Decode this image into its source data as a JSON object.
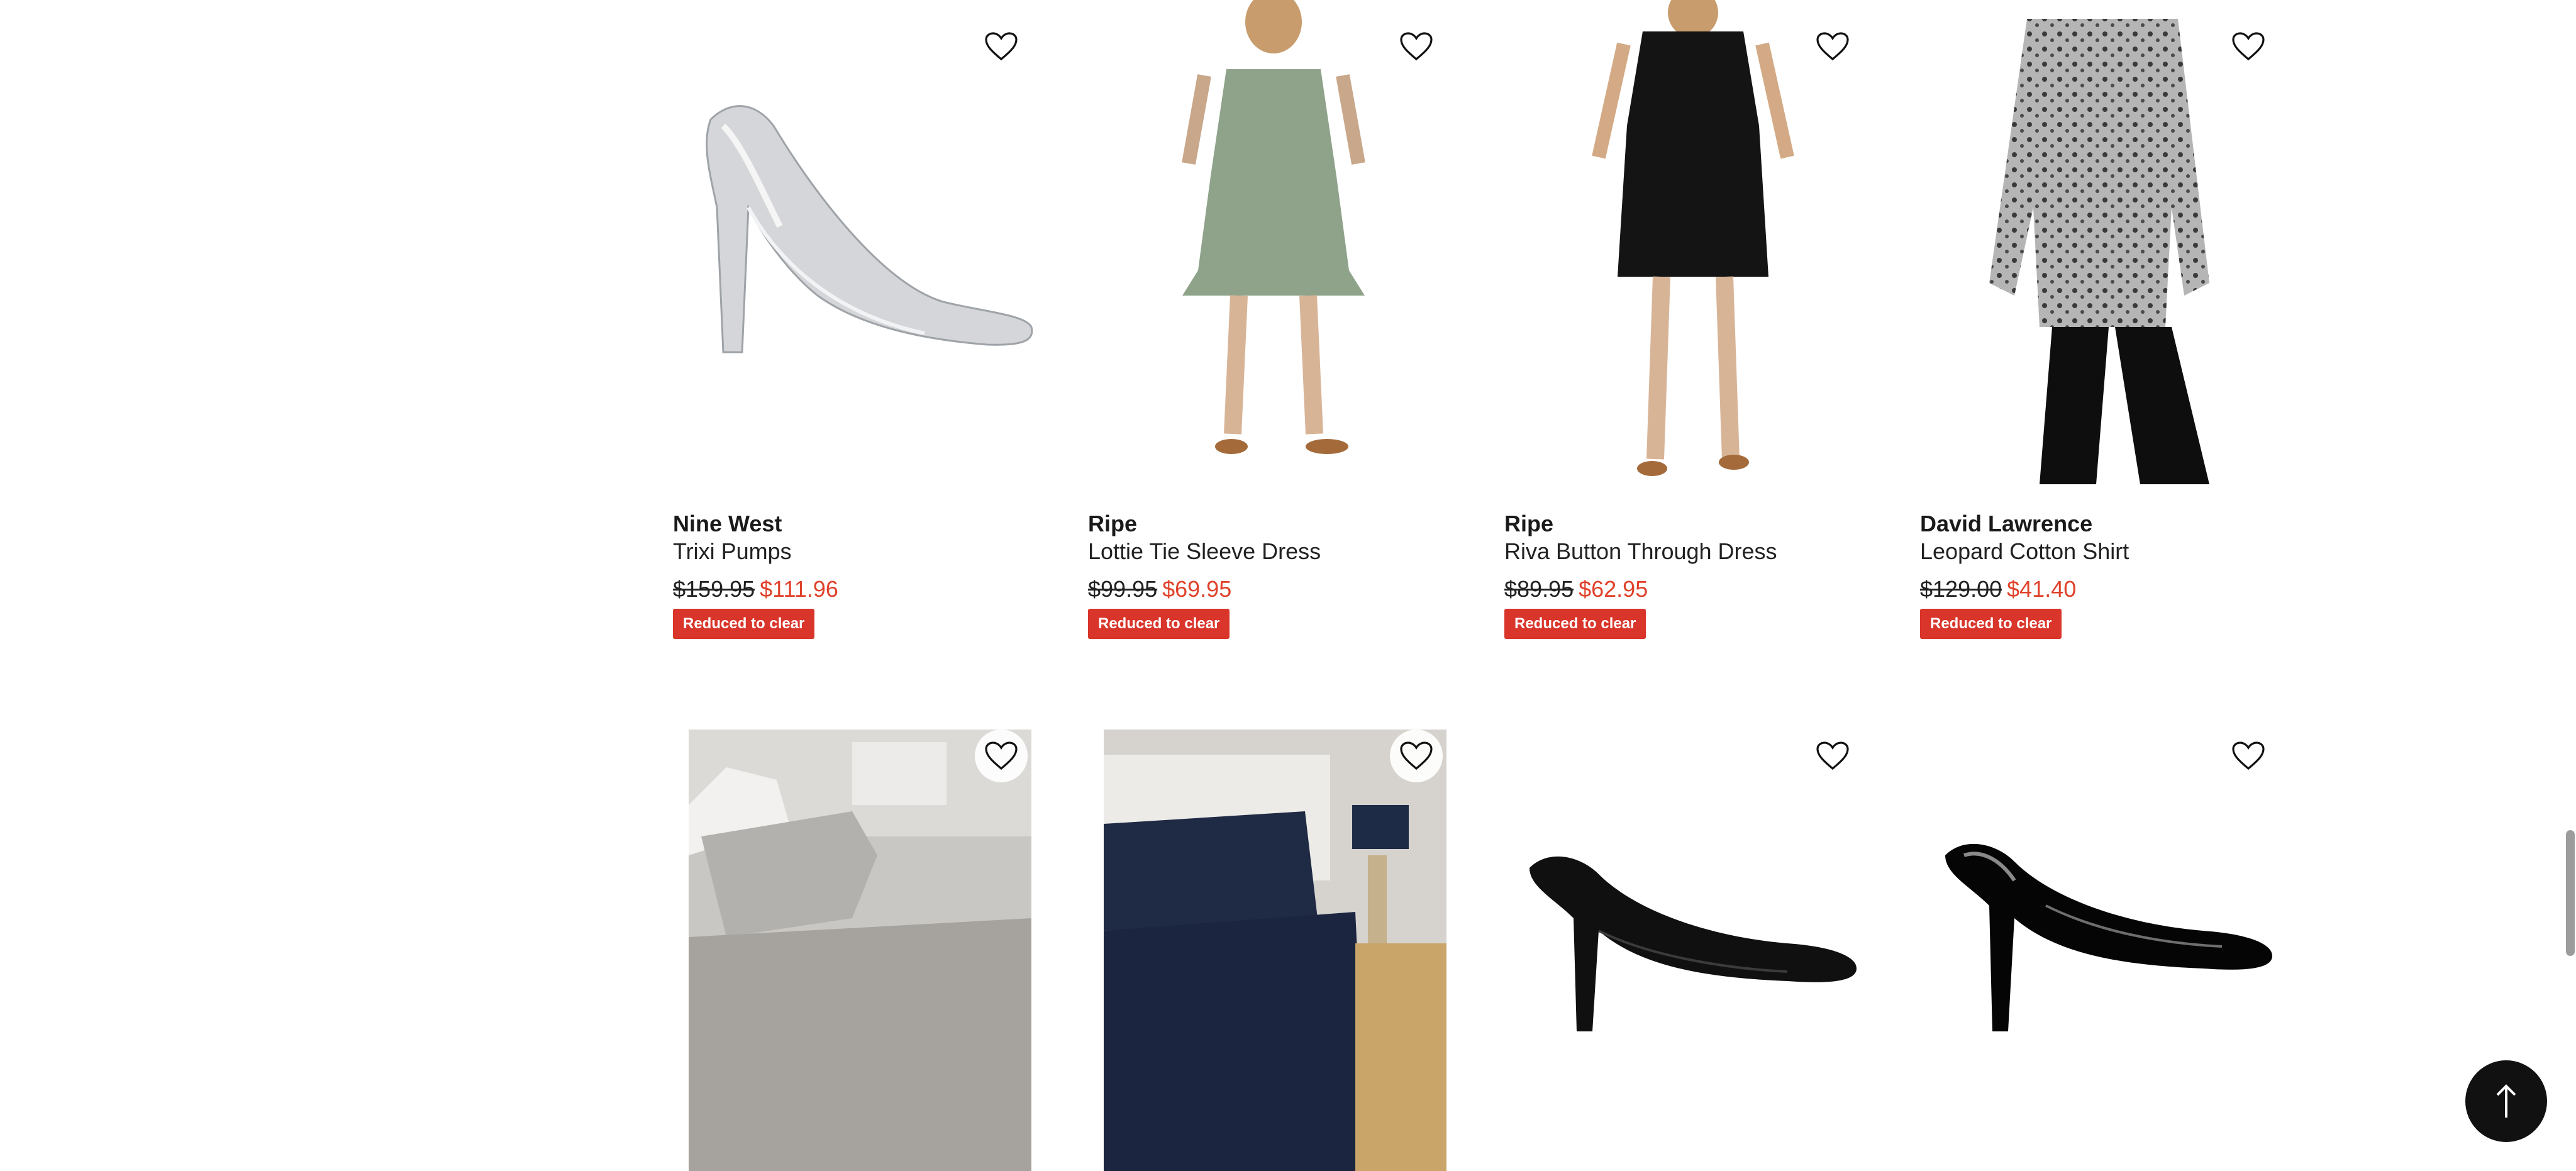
{
  "products": [
    {
      "brand": "Nine West",
      "name": "Trixi Pumps",
      "was_price": "$159.95",
      "now_price": "$111.96",
      "badge": "Reduced to clear",
      "image_icon": "silver-pump-image"
    },
    {
      "brand": "Ripe",
      "name": "Lottie Tie Sleeve Dress",
      "was_price": "$99.95",
      "now_price": "$69.95",
      "badge": "Reduced to clear",
      "image_icon": "green-dress-image"
    },
    {
      "brand": "Ripe",
      "name": "Riva Button Through Dress",
      "was_price": "$89.95",
      "now_price": "$62.95",
      "badge": "Reduced to clear",
      "image_icon": "black-dress-image"
    },
    {
      "brand": "David Lawrence",
      "name": "Leopard Cotton Shirt",
      "was_price": "$129.00",
      "now_price": "$41.40",
      "badge": "Reduced to clear",
      "image_icon": "leopard-shirt-image"
    }
  ],
  "second_row": [
    {
      "image_icon": "grey-sheets-image"
    },
    {
      "image_icon": "navy-quilt-image"
    },
    {
      "image_icon": "black-pump-image"
    },
    {
      "image_icon": "patent-pump-image"
    }
  ],
  "colors": {
    "sale_price": "#e0412a",
    "badge_bg": "#d9352b",
    "to_top_bg": "#111111"
  }
}
